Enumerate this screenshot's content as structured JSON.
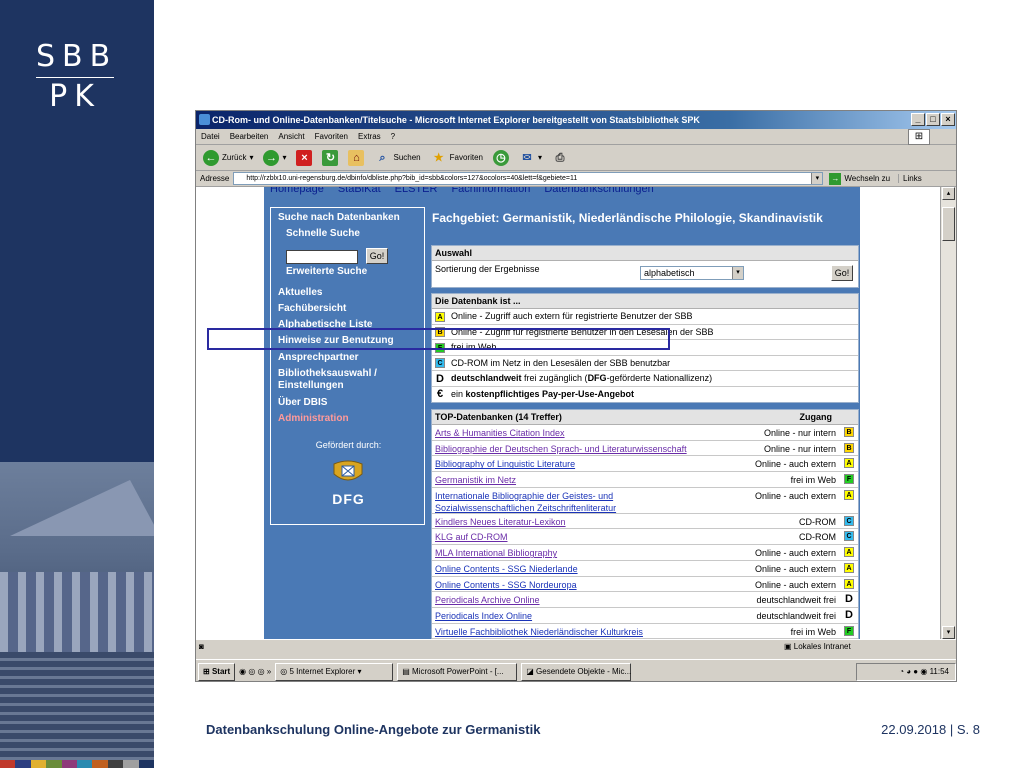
{
  "logo": {
    "line1": "SBB",
    "line2": "PK"
  },
  "browser": {
    "title": "CD-Rom- und Online-Datenbanken/Titelsuche - Microsoft Internet Explorer bereitgestellt von Staatsbibliothek SPK",
    "menu": [
      "Datei",
      "Bearbeiten",
      "Ansicht",
      "Favoriten",
      "Extras",
      "?"
    ],
    "toolbar": {
      "back": "Zurück",
      "search": "Suchen",
      "favorites": "Favoriten"
    },
    "address_label": "Adresse",
    "address": "http://rzblx10.uni-regensburg.de/dbinfo/dbliste.php?bib_id=sbb&colors=127&ocolors=40&lett=f&gebiete=11",
    "go": "Wechseln zu",
    "links": "Links",
    "status_zone": "Lokales Intranet"
  },
  "page": {
    "topnav": [
      "Homepage",
      "StaBiKat",
      "ELSTER",
      "Fachinformation",
      "Datenbankschulungen"
    ],
    "sidebar": {
      "search_heading": "Suche nach Datenbanken",
      "quick_search": "Schnelle Suche",
      "go": "Go!",
      "advanced": "Erweiterte Suche",
      "links": [
        "Aktuelles",
        "Fachübersicht",
        "Alphabetische Liste",
        "Hinweise zur Benutzung",
        "Ansprechpartner",
        "Bibliotheksauswahl /",
        "Einstellungen",
        "Über DBIS"
      ],
      "admin": "Administration",
      "funded": "Gefördert durch:",
      "dfg": "DFG"
    },
    "title": "Fachgebiet: Germanistik, Niederländische Philologie, Skandinavistik",
    "auswahl": {
      "heading": "Auswahl",
      "sort_label": "Sortierung der Ergebnisse",
      "sort_value": "alphabetisch",
      "go": "Go!"
    },
    "legend": {
      "heading": "Die Datenbank ist ...",
      "items": [
        {
          "badge": "A",
          "text": "Online - Zugriff auch extern für registrierte Benutzer der SBB"
        },
        {
          "badge": "B",
          "text": "Online - Zugriff für registrierte Benutzer in den Lesesälen der SBB"
        },
        {
          "badge": "F",
          "text": "frei im Web"
        },
        {
          "badge": "C",
          "text": "CD-ROM im Netz in den Lesesälen der SBB benutzbar"
        },
        {
          "badge": "D",
          "text_bold": "deutschlandweit",
          "text": " frei zugänglich (",
          "text_bold2": "DFG",
          "text2": "-geförderte Nationallizenz)"
        },
        {
          "badge": "€",
          "text": "ein ",
          "text_bold": "kostenpflichtiges Pay-per-Use-Angebot"
        }
      ]
    },
    "top": {
      "heading": "TOP-Datenbanken (14 Treffer)",
      "access_heading": "Zugang",
      "rows": [
        {
          "name": "Arts & Humanities Citation Index",
          "access": "Online - nur intern",
          "badge": "B"
        },
        {
          "name": "Bibliographie der Deutschen Sprach- und Literaturwissenschaft",
          "access": "Online - nur intern",
          "badge": "B"
        },
        {
          "name": "Bibliography of Linguistic Literature",
          "access": "Online - auch extern",
          "badge": "A"
        },
        {
          "name": "Germanistik im Netz",
          "access": "frei im Web",
          "badge": "F"
        },
        {
          "name": "Internationale Bibliographie der Geistes- und",
          "name2": "Sozialwissenschaftlichen Zeitschriftenliteratur",
          "access": "Online - auch extern",
          "badge": "A"
        },
        {
          "name": "Kindlers Neues Literatur-Lexikon",
          "access": "CD-ROM",
          "badge": "C"
        },
        {
          "name": "KLG auf CD-ROM",
          "access": "CD-ROM",
          "badge": "C"
        },
        {
          "name": "MLA International Bibliography",
          "access": "Online - auch extern",
          "badge": "A"
        },
        {
          "name": "Online Contents - SSG Niederlande",
          "access": "Online - auch extern",
          "badge": "A"
        },
        {
          "name": "Online Contents - SSG Nordeuropa",
          "access": "Online - auch extern",
          "badge": "A"
        },
        {
          "name": "Periodicals Archive Online",
          "access": "deutschlandweit frei",
          "badge": "D"
        },
        {
          "name": "Periodicals Index Online",
          "access": "deutschlandweit frei",
          "badge": "D"
        },
        {
          "name": "Virtuelle Fachbibliothek Niederländischer Kulturkreis",
          "access": "frei im Web",
          "badge": "F"
        }
      ]
    }
  },
  "taskbar": {
    "start": "Start",
    "items": [
      "5 Internet Explorer",
      "Microsoft PowerPoint - [...",
      "Gesendete Objekte - Mic..."
    ],
    "clock": "11:54"
  },
  "footer": {
    "title": "Datenbankschulung Online-Angebote zur Germanistik",
    "date": "22.09.2018",
    "sep": "|",
    "page": "S. 8"
  },
  "colors": {
    "brand": "#1e3461",
    "page_blue": "#4a79b5",
    "highlight": "#2a2aa0"
  }
}
